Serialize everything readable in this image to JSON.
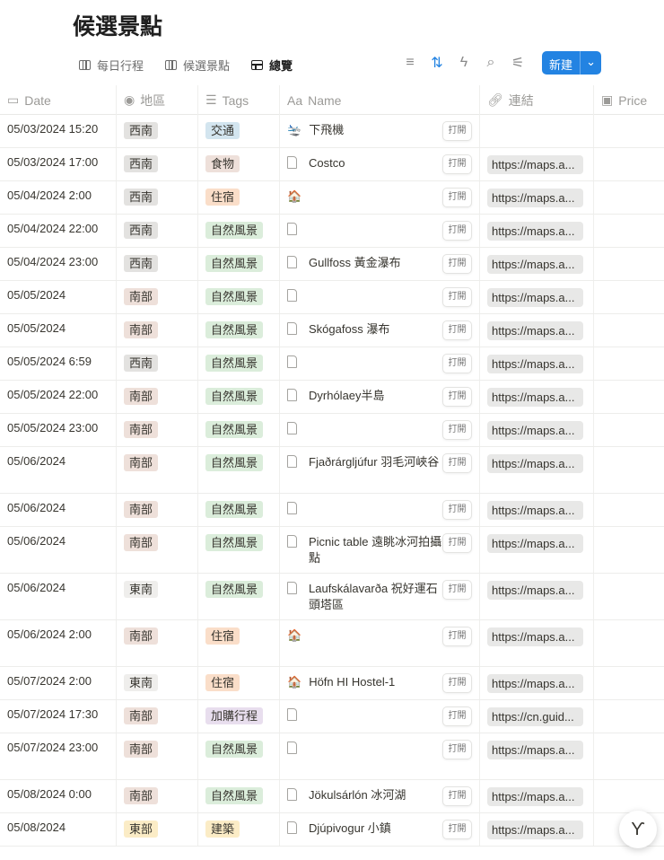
{
  "page_title": "候選景點",
  "views": [
    {
      "label": "每日行程",
      "type": "board"
    },
    {
      "label": "候選景點",
      "type": "board"
    },
    {
      "label": "總覽",
      "type": "table",
      "active": true
    }
  ],
  "toolbar": {
    "new_label": "新建"
  },
  "columns": {
    "date": "Date",
    "region": "地區",
    "tags": "Tags",
    "name": "Name",
    "link": "連結",
    "price": "Price"
  },
  "open_label": "打開",
  "colors": {
    "gray": "#e3e2e0",
    "lightgray": "#efeeec",
    "brown": "#eee0da",
    "orange": "#fadec9",
    "yellow": "#fbecc6",
    "green": "#dbeddb",
    "blue": "#d3e5ef",
    "purple": "#e8deee",
    "accent": "#2383e2"
  },
  "rows": [
    {
      "date": "05/03/2024 15:20",
      "region": "西南",
      "region_color": "gray",
      "tag": "交通",
      "tag_color": "blue",
      "icon": "airplane",
      "name": "下飛機",
      "link": "",
      "tall": false
    },
    {
      "date": "05/03/2024 17:00",
      "region": "西南",
      "region_color": "gray",
      "tag": "食物",
      "tag_color": "brown",
      "icon": "doc",
      "name": "Costco",
      "link": "https://maps.a...",
      "tall": false
    },
    {
      "date": "05/04/2024 2:00",
      "region": "西南",
      "region_color": "gray",
      "tag": "住宿",
      "tag_color": "orange",
      "icon": "house",
      "name": "",
      "link": "https://maps.a...",
      "tall": false
    },
    {
      "date": "05/04/2024 22:00",
      "region": "西南",
      "region_color": "gray",
      "tag": "自然風景",
      "tag_color": "green",
      "icon": "doc",
      "name": "",
      "link": "https://maps.a...",
      "tall": false
    },
    {
      "date": "05/04/2024 23:00",
      "region": "西南",
      "region_color": "gray",
      "tag": "自然風景",
      "tag_color": "green",
      "icon": "doc",
      "name": "Gullfoss 黃金瀑布",
      "link": "https://maps.a...",
      "tall": false
    },
    {
      "date": "05/05/2024",
      "region": "南部",
      "region_color": "brown",
      "tag": "自然風景",
      "tag_color": "green",
      "icon": "doc",
      "name": "",
      "link": "https://maps.a...",
      "tall": false
    },
    {
      "date": "05/05/2024",
      "region": "南部",
      "region_color": "brown",
      "tag": "自然風景",
      "tag_color": "green",
      "icon": "doc",
      "name": "Skógafoss 瀑布",
      "link": "https://maps.a...",
      "tall": false
    },
    {
      "date": "05/05/2024 6:59",
      "region": "西南",
      "region_color": "gray",
      "tag": "自然風景",
      "tag_color": "green",
      "icon": "doc",
      "name": "",
      "link": "https://maps.a...",
      "tall": false
    },
    {
      "date": "05/05/2024 22:00",
      "region": "南部",
      "region_color": "brown",
      "tag": "自然風景",
      "tag_color": "green",
      "icon": "doc",
      "name": "Dyrhólaey半島",
      "link": "https://maps.a...",
      "tall": false
    },
    {
      "date": "05/05/2024 23:00",
      "region": "南部",
      "region_color": "brown",
      "tag": "自然風景",
      "tag_color": "green",
      "icon": "doc",
      "name": "",
      "link": "https://maps.a...",
      "tall": false
    },
    {
      "date": "05/06/2024",
      "region": "南部",
      "region_color": "brown",
      "tag": "自然風景",
      "tag_color": "green",
      "icon": "doc",
      "name": "Fjaðrárgljúfur 羽毛河峽谷",
      "link": "https://maps.a...",
      "tall": true
    },
    {
      "date": "05/06/2024",
      "region": "南部",
      "region_color": "brown",
      "tag": "自然風景",
      "tag_color": "green",
      "icon": "doc",
      "name": "",
      "link": "https://maps.a...",
      "tall": false
    },
    {
      "date": "05/06/2024",
      "region": "南部",
      "region_color": "brown",
      "tag": "自然風景",
      "tag_color": "green",
      "icon": "doc",
      "name": "Picnic table 遠眺冰河拍攝點",
      "link": "https://maps.a...",
      "tall": true
    },
    {
      "date": "05/06/2024",
      "region": "東南",
      "region_color": "lightgray",
      "tag": "自然風景",
      "tag_color": "green",
      "icon": "doc",
      "name": "Laufskálavarða 祝好運石頭塔區",
      "link": "https://maps.a...",
      "tall": true
    },
    {
      "date": "05/06/2024 2:00",
      "region": "南部",
      "region_color": "brown",
      "tag": "住宿",
      "tag_color": "orange",
      "icon": "house",
      "name": "",
      "link": "https://maps.a...",
      "tall": true
    },
    {
      "date": "05/07/2024 2:00",
      "region": "東南",
      "region_color": "lightgray",
      "tag": "住宿",
      "tag_color": "orange",
      "icon": "house",
      "name": "Höfn HI Hostel-1",
      "link": "https://maps.a...",
      "tall": false
    },
    {
      "date": "05/07/2024 17:30",
      "region": "南部",
      "region_color": "brown",
      "tag": "加購行程",
      "tag_color": "purple",
      "icon": "doc",
      "name": "",
      "link": "https://cn.guid...",
      "tall": false
    },
    {
      "date": "05/07/2024 23:00",
      "region": "南部",
      "region_color": "brown",
      "tag": "自然風景",
      "tag_color": "green",
      "icon": "doc",
      "name": "",
      "link": "https://maps.a...",
      "tall": true
    },
    {
      "date": "05/08/2024 0:00",
      "region": "南部",
      "region_color": "brown",
      "tag": "自然風景",
      "tag_color": "green",
      "icon": "doc",
      "name": "Jökulsárlón 冰河湖",
      "link": "https://maps.a...",
      "tall": false
    },
    {
      "date": "05/08/2024",
      "region": "東部",
      "region_color": "yellow",
      "tag": "建築",
      "tag_color": "yellow",
      "icon": "doc",
      "name": "Djúpivogur 小鎮",
      "link": "https://maps.a...",
      "tall": false
    }
  ]
}
